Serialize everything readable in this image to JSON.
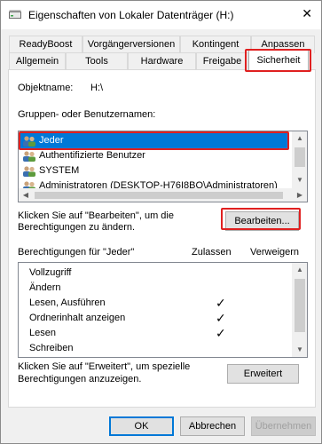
{
  "window": {
    "title": "Eigenschaften von Lokaler Datenträger (H:)",
    "close_symbol": "✕"
  },
  "tabs": {
    "row1": [
      "ReadyBoost",
      "Vorgängerversionen",
      "Kontingent",
      "Anpassen"
    ],
    "row2": [
      "Allgemein",
      "Tools",
      "Hardware",
      "Freigabe",
      "Sicherheit"
    ],
    "active": "Sicherheit"
  },
  "object": {
    "label": "Objektname:",
    "value": "H:\\"
  },
  "groups": {
    "label": "Gruppen- oder Benutzernamen:",
    "items": [
      "Jeder",
      "Authentifizierte Benutzer",
      "SYSTEM",
      "Administratoren (DESKTOP-H76I8BQ\\Administratoren)"
    ],
    "selected": "Jeder"
  },
  "edit": {
    "text_line1": "Klicken Sie auf \"Bearbeiten\", um die",
    "text_line2": "Berechtigungen zu ändern.",
    "button_label": "Bearbeiten..."
  },
  "permissions": {
    "label": "Berechtigungen für \"Jeder\"",
    "col_allow": "Zulassen",
    "col_deny": "Verweigern",
    "rows": [
      {
        "name": "Vollzugriff",
        "allow": "",
        "deny": ""
      },
      {
        "name": "Ändern",
        "allow": "",
        "deny": ""
      },
      {
        "name": "Lesen, Ausführen",
        "allow": "✓",
        "deny": ""
      },
      {
        "name": "Ordnerinhalt anzeigen",
        "allow": "✓",
        "deny": ""
      },
      {
        "name": "Lesen",
        "allow": "✓",
        "deny": ""
      },
      {
        "name": "Schreiben",
        "allow": "",
        "deny": ""
      }
    ]
  },
  "advanced": {
    "text_line1": "Klicken Sie auf \"Erweitert\", um spezielle",
    "text_line2": "Berechtigungen anzuzeigen.",
    "button_label": "Erweitert"
  },
  "footer": {
    "ok": "OK",
    "cancel": "Abbrechen",
    "apply": "Übernehmen"
  },
  "colors": {
    "selection": "#0078d7",
    "highlight_box": "#e02020"
  }
}
